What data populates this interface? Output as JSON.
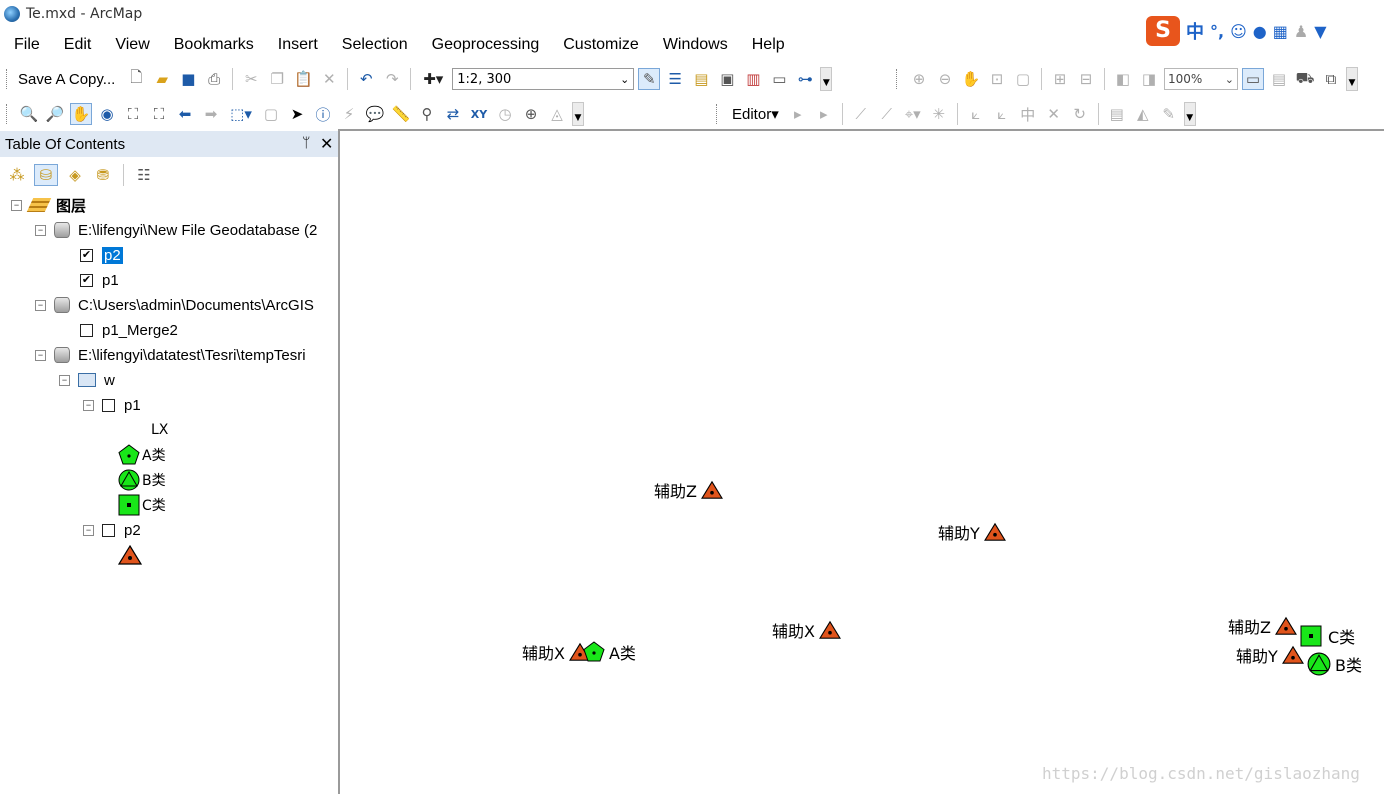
{
  "window": {
    "title": "Te.mxd - ArcMap"
  },
  "ime": {
    "logo": "S",
    "lang": "中",
    "punct": "°,"
  },
  "menu": [
    "File",
    "Edit",
    "View",
    "Bookmarks",
    "Insert",
    "Selection",
    "Geoprocessing",
    "Customize",
    "Windows",
    "Help"
  ],
  "toolbar": {
    "save_copy": "Save A Copy...",
    "scale": "1:2, 300",
    "zoom": "100%",
    "editor": "Editor"
  },
  "toc": {
    "title": "Table Of Contents",
    "pin": "ᛘ",
    "close": "✕",
    "root": "图层",
    "sources": [
      {
        "path": "E:\\lifengyi\\New File Geodatabase (2"
      },
      {
        "path": "C:\\Users\\admin\\Documents\\ArcGIS"
      },
      {
        "path": "E:\\lifengyi\\datatest\\Tesri\\tempTesri"
      }
    ],
    "layers": {
      "p2_selected": "p2",
      "p1": "p1",
      "p1_merge2": "p1_Merge2",
      "group_w": "w",
      "w_p1": "p1",
      "w_p2": "p2"
    },
    "legend": {
      "field": "LX",
      "class_a": "A类",
      "class_b": "B类",
      "class_c": "C类"
    }
  },
  "map": {
    "labels": {
      "aux_z1": "辅助Z",
      "aux_y1": "辅助Y",
      "aux_x1": "辅助X",
      "aux_x2": "辅助X",
      "class_a": "A类",
      "aux_z2": "辅助Z",
      "class_c": "C类",
      "aux_y2": "辅助Y",
      "class_b": "B类"
    }
  },
  "watermark": "https://blog.csdn.net/gislaozhang",
  "colors": {
    "triangle": "#e0541c",
    "green": "#19e619",
    "selection": "#0078d7"
  }
}
